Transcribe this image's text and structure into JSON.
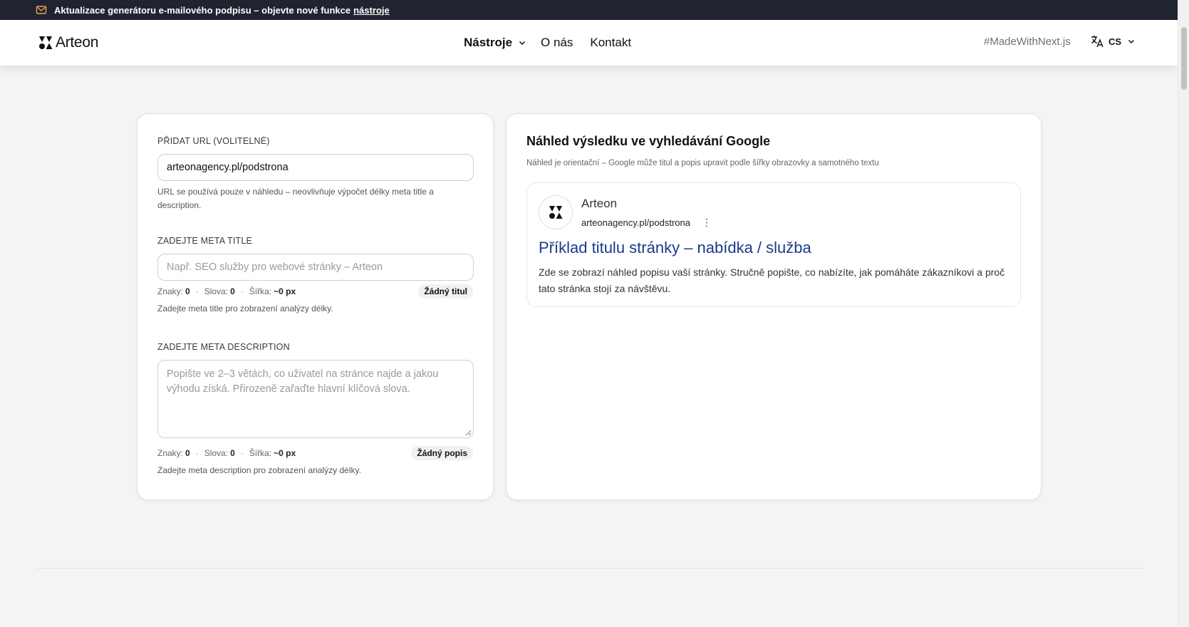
{
  "announcement": {
    "text": "Aktualizace generátoru e-mailového podpisu – objevte nové funkce",
    "link": "nástroje"
  },
  "header": {
    "logo": "Arteon",
    "nav": {
      "tools": "Nástroje",
      "about": "O nás",
      "contact": "Kontakt"
    },
    "made_with": "#MadeWithNext.js",
    "language": "CS"
  },
  "form": {
    "url": {
      "label": "PŘIDAT URL (VOLITELNÉ)",
      "value": "arteonagency.pl/podstrona",
      "help": "URL se používá pouze v náhledu – neovlivňuje výpočet délky meta title a description."
    },
    "meta_title": {
      "label": "ZADEJTE META TITLE",
      "placeholder": "Např. SEO služby pro webové stránky – Arteon",
      "stats": {
        "chars_label": "Znaky:",
        "chars": "0",
        "words_label": "Slova:",
        "words": "0",
        "width_label": "Šířka:",
        "width": "~0 px"
      },
      "badge": "Žádný titul",
      "help": "Zadejte meta title pro zobrazení analýzy délky."
    },
    "meta_description": {
      "label": "ZADEJTE META DESCRIPTION",
      "placeholder": "Popište ve 2–3 větách, co uživatel na stránce najde a jakou výhodu získá. Přirozeně zařaďte hlavní klíčová slova.",
      "stats": {
        "chars_label": "Znaky:",
        "chars": "0",
        "words_label": "Slova:",
        "words": "0",
        "width_label": "Šířka:",
        "width": "~0 px"
      },
      "badge": "Žádný popis",
      "help": "Zadejte meta description pro zobrazení analýzy délky."
    }
  },
  "preview": {
    "title": "Náhled výsledku ve vyhledávání Google",
    "subtitle": "Náhled je orientační – Google může titul a popis upravit podle šířky obrazovky a samotného textu",
    "serp": {
      "site_name": "Arteon",
      "url": "arteonagency.pl/podstrona",
      "more": "⋮",
      "title": "Příklad titulu stránky – nabídka / služba",
      "description": "Zde se zobrazí náhled popisu vaší stránky. Stručně popište, co nabízíte, jak pomáháte zákazníkovi a proč tato stránka stojí za návštěvu."
    }
  },
  "colors": {
    "announcement_bg": "#1f2430",
    "serp_title": "#1a3a8a",
    "page_bg": "#f4f4f4"
  }
}
